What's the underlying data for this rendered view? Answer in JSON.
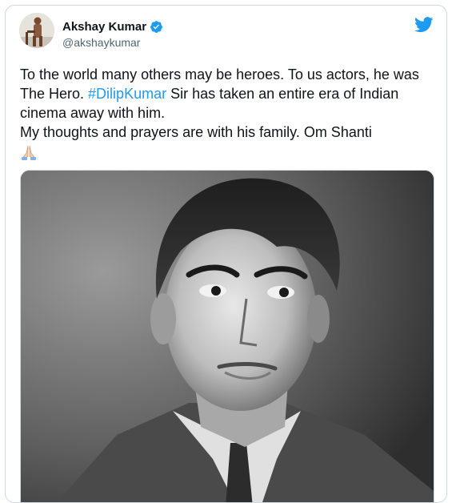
{
  "tweet": {
    "author": {
      "display_name": "Akshay Kumar",
      "handle": "@akshaykumar",
      "verified_icon": "verified-badge-icon",
      "avatar_icon": "avatar-photo"
    },
    "platform_icon": "twitter-bird-icon",
    "text_line1": "To the world many others may be heroes. To us actors, he was The Hero. ",
    "hashtag": "#DilipKumar",
    "text_line1_rest": " Sir has taken an entire era of Indian cinema away with him.",
    "text_line2": "My thoughts and prayers are with his family. Om Shanti",
    "emoji_icon": "folded-hands-icon"
  },
  "colors": {
    "accent": "#1d9bf0",
    "text": "#0f1419",
    "muted": "#536471",
    "border": "#cfd9de"
  }
}
